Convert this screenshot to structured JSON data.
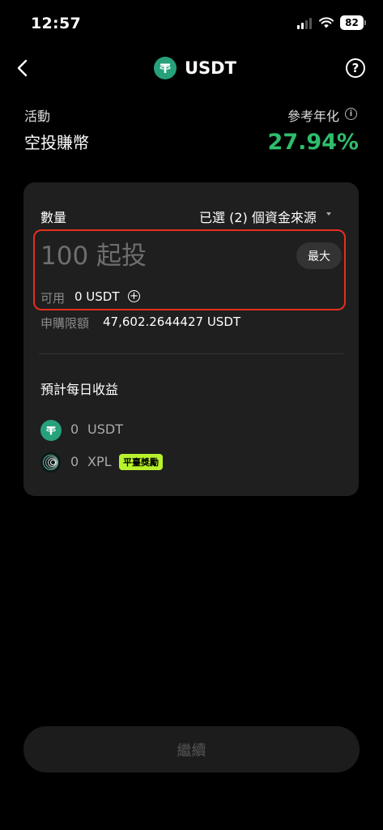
{
  "status_bar": {
    "time": "12:57",
    "battery": "82"
  },
  "header": {
    "title": "USDT"
  },
  "activity": {
    "label": "活動",
    "value": "空投賺幣"
  },
  "apr": {
    "label": "參考年化",
    "value": "27.94%"
  },
  "subscription": {
    "amount_label": "數量",
    "source_label": "已選 (2) 個資金來源",
    "amount_placeholder": "100 起投",
    "max_label": "最大",
    "available_label": "可用",
    "available_value": "0 USDT",
    "limit_label": "申購限額",
    "limit_value": "47,602.2644427 USDT"
  },
  "estimate": {
    "label": "預計每日收益",
    "rows": [
      {
        "amount": "0",
        "symbol": "USDT",
        "icon": "tether-icon"
      },
      {
        "amount": "0",
        "symbol": "XPL",
        "icon": "xpl-icon",
        "badge": "平臺獎勵"
      }
    ]
  },
  "footer": {
    "continue_label": "繼續"
  },
  "colors": {
    "apr_green": "#2ebd6b",
    "tether_green": "#26a17b",
    "input_highlight": "#e4301e",
    "badge_lime": "#b8f22c"
  }
}
